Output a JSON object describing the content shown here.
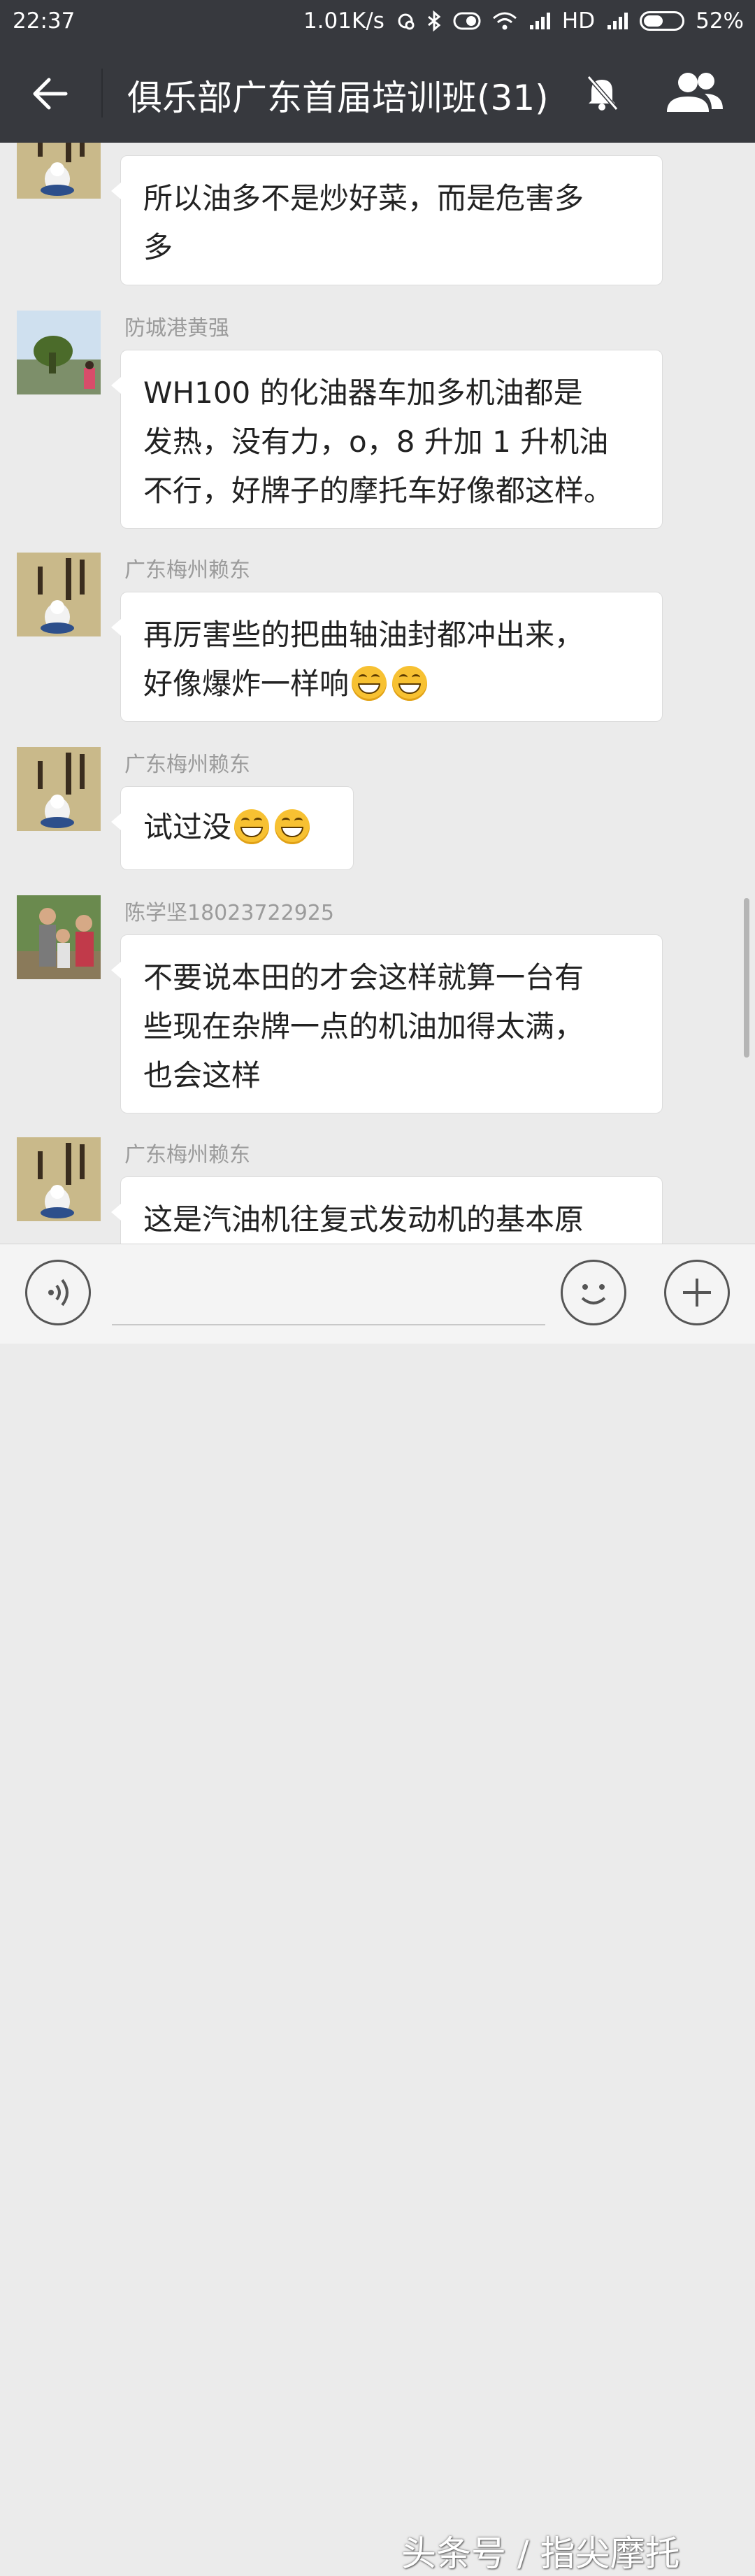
{
  "status_bar": {
    "time": "22:37",
    "network_speed": "1.01K/s",
    "hd_label": "HD",
    "battery_percent": "52%",
    "battery_level": 0.52
  },
  "header": {
    "title": "俱乐部广东首届培训班(31)"
  },
  "messages": [
    {
      "sender": "",
      "lines": [
        "所以油多不是炒好菜，而是危害多",
        "多"
      ]
    },
    {
      "sender": "防城港黄强",
      "lines": [
        "WH100 的化油器车加多机油都是",
        "发热，没有力，o，8 升加 1 升机油",
        "不行，好牌子的摩托车好像都这样。"
      ]
    },
    {
      "sender": "广东梅州赖东",
      "lines": [
        "再厉害些的把曲轴油封都冲出来，",
        "好像爆炸一样响"
      ],
      "emoji_count": 2
    },
    {
      "sender": "广东梅州赖东",
      "lines": [
        "试过没"
      ],
      "emoji_count": 2
    },
    {
      "sender": "陈学坚18023722925",
      "lines": [
        "不要说本田的才会这样就算一台有",
        "些现在杂牌一点的机油加得太满，",
        "也会这样"
      ]
    },
    {
      "sender": "广东梅州赖东",
      "lines": [
        "这是汽油机往复式发动机的基本原"
      ]
    }
  ],
  "watermark": "头条号 / 指尖摩托",
  "colors": {
    "header_bg": "#37393e",
    "chat_bg": "#ebebeb",
    "bubble_bg": "#ffffff"
  }
}
